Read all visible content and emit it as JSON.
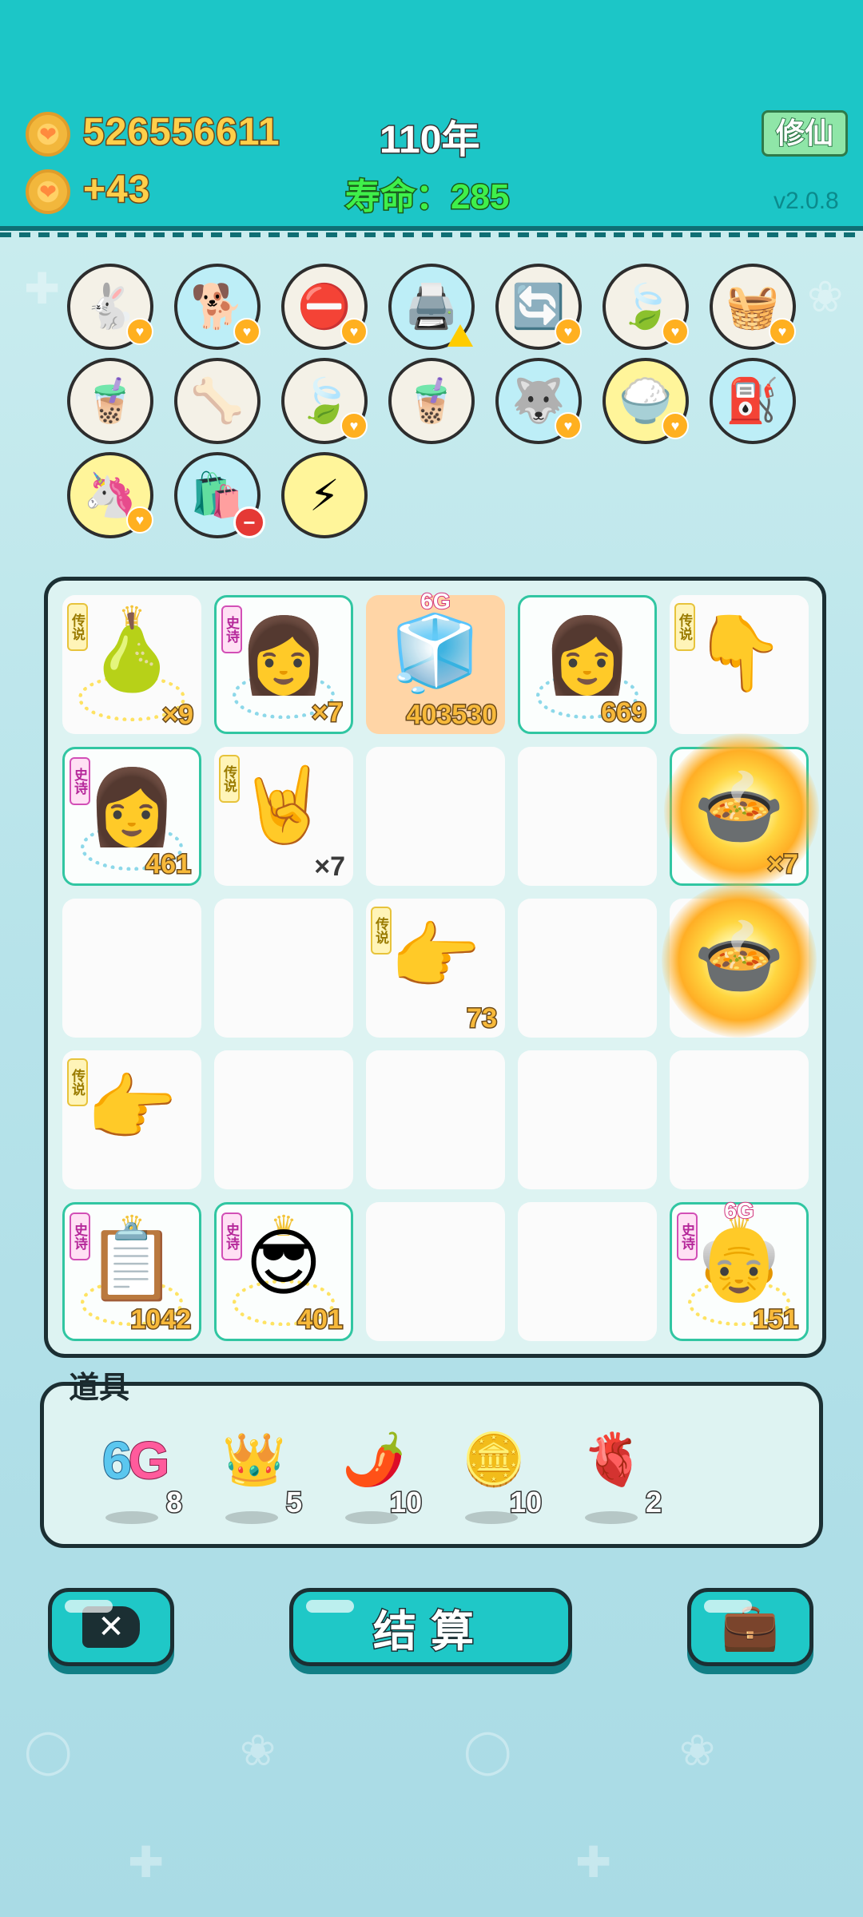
{
  "header": {
    "coins": "526556611",
    "income": "+43",
    "year": "110年",
    "lifespan": "寿命：285",
    "cultivate_button": "修仙",
    "version": "v2.0.8"
  },
  "round_items": [
    {
      "name": "rabbit-icon",
      "glyph": "🐇",
      "bg": "#f4f1e7",
      "badge": "heart"
    },
    {
      "name": "dog-icon",
      "glyph": "🐕",
      "bg": "#bdeef7",
      "badge": "heart"
    },
    {
      "name": "no-entry-icon",
      "glyph": "⛔",
      "bg": "#f4f1e7",
      "badge": "heart"
    },
    {
      "name": "printer-icon",
      "glyph": "🖨️",
      "bg": "#bdeef7",
      "badge": "warn"
    },
    {
      "name": "refresh-icon",
      "glyph": "🔄",
      "bg": "#f4f1e7",
      "badge": "heart"
    },
    {
      "name": "leaf-icon",
      "glyph": "🍃",
      "bg": "#f4f1e7",
      "badge": "heart"
    },
    {
      "name": "fruit-basket-icon",
      "glyph": "🧺",
      "bg": "#f4f1e7",
      "badge": "heart"
    },
    {
      "name": "milk-tea-icon",
      "glyph": "🧋",
      "bg": "#f4f1e7",
      "badge": ""
    },
    {
      "name": "dog-bowl-icon",
      "glyph": "🦴",
      "bg": "#f4f1e7",
      "badge": ""
    },
    {
      "name": "leaf-icon",
      "glyph": "🍃",
      "bg": "#f4f1e7",
      "badge": "heart"
    },
    {
      "name": "milk-tea-icon",
      "glyph": "🧋",
      "bg": "#f4f1e7",
      "badge": ""
    },
    {
      "name": "husky-icon",
      "glyph": "🐺",
      "bg": "#bdeef7",
      "badge": "heart"
    },
    {
      "name": "rice-bowl-icon",
      "glyph": "🍚",
      "bg": "#fff59a",
      "badge": "heart"
    },
    {
      "name": "pump-icon",
      "glyph": "⛽",
      "bg": "#bdeef7",
      "badge": ""
    },
    {
      "name": "unicorn-icon",
      "glyph": "🦄",
      "bg": "#fff59a",
      "badge": "heart"
    },
    {
      "name": "garbage-bag-icon",
      "glyph": "🛍️",
      "bg": "#bdeef7",
      "badge": "minus"
    },
    {
      "name": "lightning-icon",
      "glyph": "⚡",
      "bg": "#fff59a",
      "badge": ""
    }
  ],
  "board": {
    "cells": [
      {
        "name": "cell-golden-fruit",
        "glyph": "🍐",
        "rarity": "传说",
        "rarity_type": "legend",
        "crown": true,
        "rune": "gold",
        "count": "×9",
        "style": ""
      },
      {
        "name": "cell-aunt-face",
        "glyph": "👩",
        "rarity": "史诗",
        "rarity_type": "epic",
        "rune": "blue",
        "count": "×7",
        "style": "teal"
      },
      {
        "name": "cell-fridge",
        "glyph": "🧊",
        "tag": "6G",
        "count": "403530",
        "style": "orange"
      },
      {
        "name": "cell-aunt-face-2",
        "glyph": "👩",
        "rune": "blue",
        "count": "669",
        "style": "teal"
      },
      {
        "name": "cell-pointing-hand",
        "glyph": "👇",
        "rarity": "传说",
        "rarity_type": "legend",
        "style": ""
      },
      {
        "name": "cell-aunt-face-3",
        "glyph": "👩",
        "rarity": "史诗",
        "rarity_type": "epic",
        "rune": "blue",
        "count": "461",
        "style": "teal"
      },
      {
        "name": "cell-rock-hand",
        "glyph": "🤘",
        "rarity": "传说",
        "rarity_type": "legend",
        "count": "×7",
        "count_dark": true,
        "style": ""
      },
      {
        "name": "cell-empty",
        "style": ""
      },
      {
        "name": "cell-empty",
        "style": ""
      },
      {
        "name": "cell-fire-pot",
        "glyph": "🍲",
        "fire": true,
        "count": "×7",
        "style": "teal"
      },
      {
        "name": "cell-empty",
        "style": ""
      },
      {
        "name": "cell-empty",
        "style": ""
      },
      {
        "name": "cell-pointing-hand-2",
        "glyph": "👉",
        "rarity": "传说",
        "rarity_type": "legend",
        "count": "73",
        "style": ""
      },
      {
        "name": "cell-empty",
        "style": ""
      },
      {
        "name": "cell-fire-pot-2",
        "glyph": "🍲",
        "fire": true,
        "style": ""
      },
      {
        "name": "cell-pointing-hand-3",
        "glyph": "👉",
        "rarity": "传说",
        "rarity_type": "legend",
        "style": ""
      },
      {
        "name": "cell-empty",
        "style": ""
      },
      {
        "name": "cell-empty",
        "style": ""
      },
      {
        "name": "cell-empty",
        "style": ""
      },
      {
        "name": "cell-empty",
        "style": ""
      },
      {
        "name": "cell-ctrl-cv",
        "glyph": "📋",
        "rarity": "史诗",
        "rarity_type": "epic",
        "crown": true,
        "rune": "gold",
        "count": "1042",
        "style": "teal"
      },
      {
        "name": "cell-cool-man",
        "glyph": "😎",
        "rarity": "史诗",
        "rarity_type": "epic",
        "crown": true,
        "rune": "gold",
        "count": "401",
        "style": "teal"
      },
      {
        "name": "cell-empty",
        "style": ""
      },
      {
        "name": "cell-empty",
        "style": ""
      },
      {
        "name": "cell-old-man",
        "glyph": "👴",
        "rarity": "史诗",
        "rarity_type": "epic",
        "crown": true,
        "tag": "6G",
        "rune": "gold",
        "count": "151",
        "style": "teal"
      }
    ]
  },
  "props": {
    "label": "道具",
    "items": [
      {
        "name": "6g-item",
        "glyph": "6G",
        "qty": "8"
      },
      {
        "name": "crown-item",
        "glyph": "👑",
        "qty": "5"
      },
      {
        "name": "chili-item",
        "glyph": "🌶️",
        "qty": "10"
      },
      {
        "name": "coin-item",
        "glyph": "🪙",
        "qty": "10"
      },
      {
        "name": "liver-item",
        "glyph": "🫀",
        "qty": "2"
      }
    ]
  },
  "buttons": {
    "settle": "结算"
  }
}
